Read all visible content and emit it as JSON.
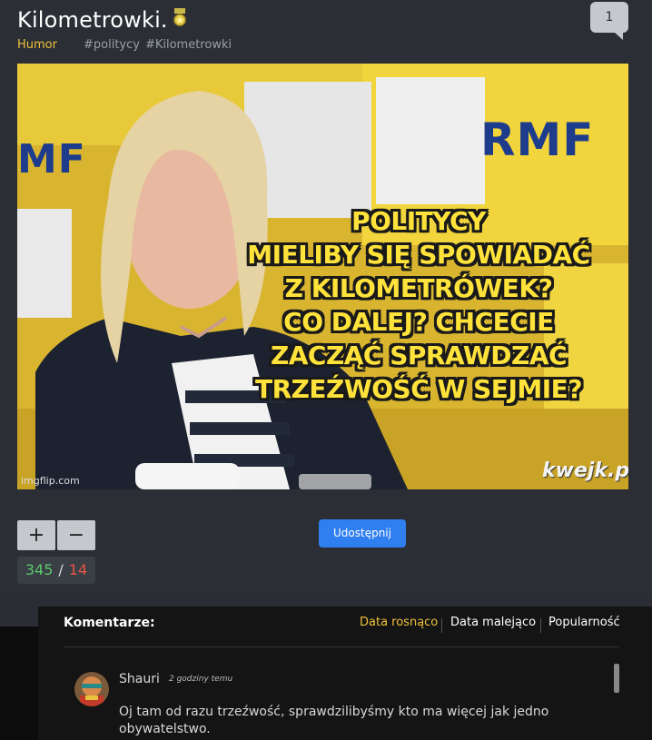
{
  "post": {
    "title": "Kilometrowki.",
    "category": "Humor",
    "tags": [
      "#politycy",
      "#Kilometrowki"
    ],
    "comment_count": "1",
    "meme": {
      "caption_lines": [
        "POLITYCY",
        "MIELIBY SIĘ SPOWIADAĆ",
        "Z KILOMETRÓWEK?",
        "CO DALEJ? CHCECIE",
        "ZACZĄĆ SPRAWDZAĆ",
        "TRZEŹWOŚĆ W SEJMIE?"
      ],
      "logo_left": "MF",
      "logo_right": "RMF",
      "watermark_imgflip": "imgflip.com",
      "watermark_kwejk": "kwejk.pl"
    },
    "votes": {
      "plus_label": "+",
      "minus_label": "−",
      "up": "345",
      "separator": "/",
      "down": "14"
    },
    "share_label": "Udostępnij"
  },
  "comments": {
    "header": "Komentarze:",
    "sort_options": [
      "Data rosnąco",
      "Data malejąco",
      "Popularność"
    ],
    "active_sort": "Data rosnąco",
    "items": [
      {
        "user": "Shauri",
        "time": "2 godziny temu",
        "text": "Oj tam od razu trzeźwość, sprawdzilibyśmy kto ma więcej jak jedno obywatelstwo."
      }
    ]
  },
  "colors": {
    "accent": "#f0c23c",
    "share": "#2f7ff0",
    "up": "#5bc86a",
    "down": "#e8564a"
  }
}
